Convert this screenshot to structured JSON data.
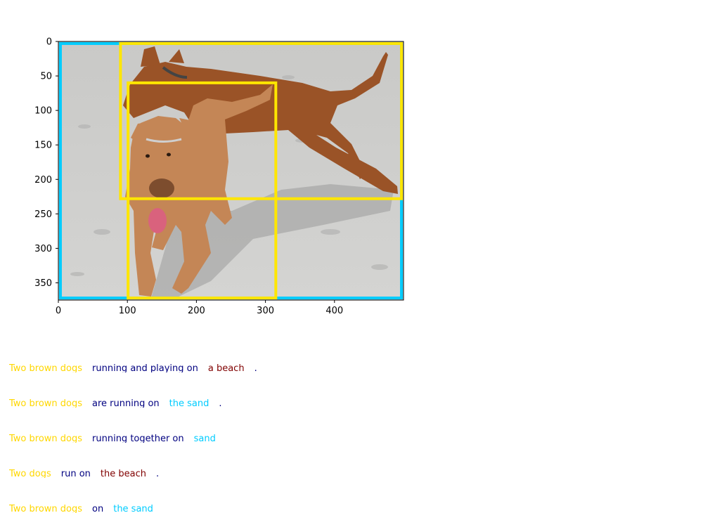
{
  "figure": {
    "x_ticks": [
      "0",
      "100",
      "200",
      "300",
      "400"
    ],
    "y_ticks": [
      "0",
      "50",
      "100",
      "150",
      "200",
      "250",
      "300",
      "350"
    ],
    "image_label": "photo of two brown dogs running on a sandy beach",
    "image_extent": {
      "width": 500,
      "height": 375
    },
    "boxes": [
      {
        "color": "#00ccff",
        "x0": 3,
        "y0": 3,
        "x1": 497,
        "y1": 372
      },
      {
        "color": "#ffe600",
        "x0": 90,
        "y0": 3,
        "x1": 497,
        "y1": 228
      },
      {
        "color": "#ffe600",
        "x0": 101,
        "y0": 60,
        "x1": 315,
        "y1": 372
      }
    ]
  },
  "captions": [
    {
      "segments": [
        {
          "text": "Two brown dogs",
          "color": "#ffd700"
        },
        {
          "text": "running and playing on",
          "color": "#000080"
        },
        {
          "text": "a beach",
          "color": "#800000"
        },
        {
          "text": ".",
          "color": "#000080"
        }
      ]
    },
    {
      "segments": [
        {
          "text": "Two brown dogs",
          "color": "#ffd700"
        },
        {
          "text": "are running on",
          "color": "#000080"
        },
        {
          "text": "the sand",
          "color": "#00ccff"
        },
        {
          "text": ".",
          "color": "#000080"
        }
      ]
    },
    {
      "segments": [
        {
          "text": "Two brown dogs",
          "color": "#ffd700"
        },
        {
          "text": "running together on",
          "color": "#000080"
        },
        {
          "text": "sand",
          "color": "#00ccff"
        }
      ]
    },
    {
      "segments": [
        {
          "text": "Two dogs",
          "color": "#ffd700"
        },
        {
          "text": "run on",
          "color": "#000080"
        },
        {
          "text": "the beach",
          "color": "#800000"
        },
        {
          "text": ".",
          "color": "#000080"
        }
      ]
    },
    {
      "segments": [
        {
          "text": "Two brown dogs",
          "color": "#ffd700"
        },
        {
          "text": "on",
          "color": "#000080"
        },
        {
          "text": "the sand",
          "color": "#00ccff"
        }
      ]
    }
  ]
}
